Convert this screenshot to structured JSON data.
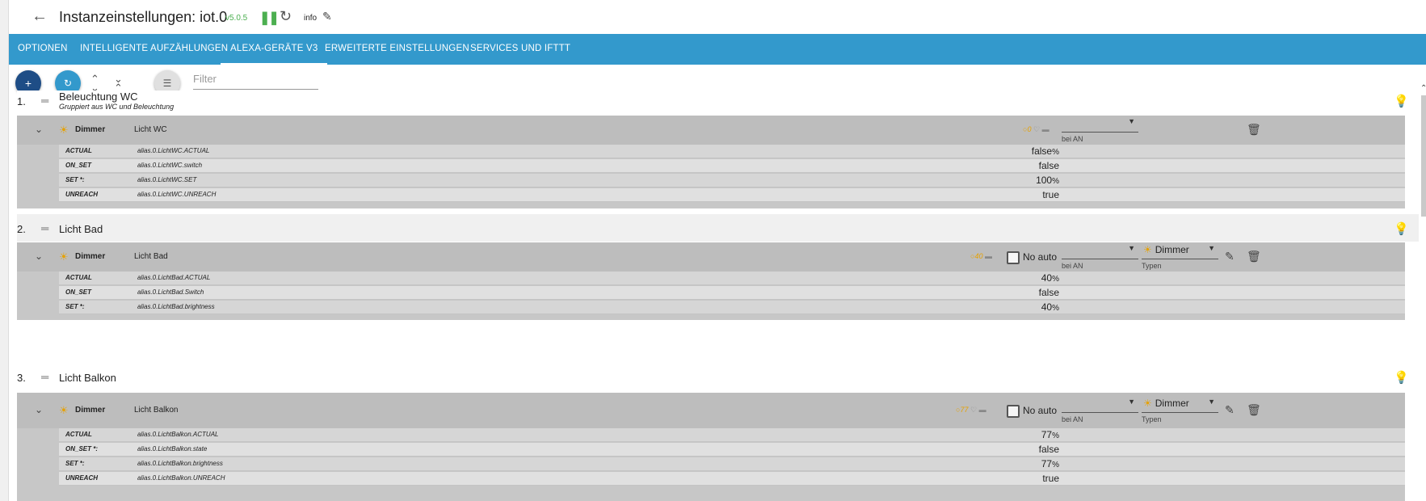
{
  "header": {
    "title": "Instanzeinstellungen: iot.0",
    "version": "v5.0.5",
    "info": "info"
  },
  "tabs": [
    "Optionen",
    "Intelligente Aufzählungen",
    "Alexa-Geräte V3",
    "Erweiterte Einstellungen",
    "Services und IFTTT"
  ],
  "active_tab": "Alexa-Geräte V3",
  "toolbar": {
    "filter_placeholder": "Filter"
  },
  "colors": {
    "tabbar": "#3399cc",
    "add_button": "#1e4d86",
    "accent": "#e6a100",
    "version": "#4caf50"
  },
  "icons": [
    "back-arrow-icon",
    "pause-icon",
    "reload-icon",
    "pencil-icon",
    "plus-icon",
    "refresh-icon",
    "expand-all-icon",
    "collapse-all-icon",
    "list-icon",
    "drag-handle-icon",
    "bulb-icon",
    "chevron-down-icon",
    "delete-icon",
    "edit-icon"
  ],
  "groups": [
    {
      "num": "1.",
      "name": "Beleuchtung WC",
      "desc": "Gruppiert aus WC und Beleuchtung",
      "device": {
        "type": "Dimmer",
        "name": "Licht WC",
        "value": "0",
        "on_label": "bei AN",
        "states": [
          {
            "name": "ACTUAL",
            "id": "alias.0.LichtWC.ACTUAL",
            "value": "false",
            "unit": "%"
          },
          {
            "name": "ON_SET",
            "id": "alias.0.LichtWC.switch",
            "value": "false",
            "unit": ""
          },
          {
            "name": "SET *:",
            "id": "alias.0.LichtWC.SET",
            "value": "100",
            "unit": "%"
          },
          {
            "name": "UNREACH",
            "id": "alias.0.LichtWC.UNREACH",
            "value": "true",
            "unit": ""
          }
        ]
      }
    },
    {
      "num": "2.",
      "name": "Licht Bad",
      "device": {
        "type": "Dimmer",
        "name": "Licht Bad",
        "value": "40",
        "no_auto": "No auto",
        "on_label": "bei AN",
        "type_select": "Dimmer",
        "types_label": "Typen",
        "states": [
          {
            "name": "ACTUAL",
            "id": "alias.0.LichtBad.ACTUAL",
            "value": "40",
            "unit": "%"
          },
          {
            "name": "ON_SET",
            "id": "alias.0.LichtBad.Switch",
            "value": "false",
            "unit": ""
          },
          {
            "name": "SET *:",
            "id": "alias.0.LichtBad.brightness",
            "value": "40",
            "unit": "%"
          }
        ]
      }
    },
    {
      "num": "3.",
      "name": "Licht Balkon",
      "device": {
        "type": "Dimmer",
        "name": "Licht Balkon",
        "value": "77",
        "no_auto": "No auto",
        "on_label": "bei AN",
        "type_select": "Dimmer",
        "types_label": "Typen",
        "states": [
          {
            "name": "ACTUAL",
            "id": "alias.0.LichtBalkon.ACTUAL",
            "value": "77",
            "unit": "%"
          },
          {
            "name": "ON_SET *:",
            "id": "alias.0.LichtBalkon.state",
            "value": "false",
            "unit": ""
          },
          {
            "name": "SET *:",
            "id": "alias.0.LichtBalkon.brightness",
            "value": "77",
            "unit": "%"
          },
          {
            "name": "UNREACH",
            "id": "alias.0.LichtBalkon.UNREACH",
            "value": "true",
            "unit": ""
          }
        ]
      }
    }
  ]
}
